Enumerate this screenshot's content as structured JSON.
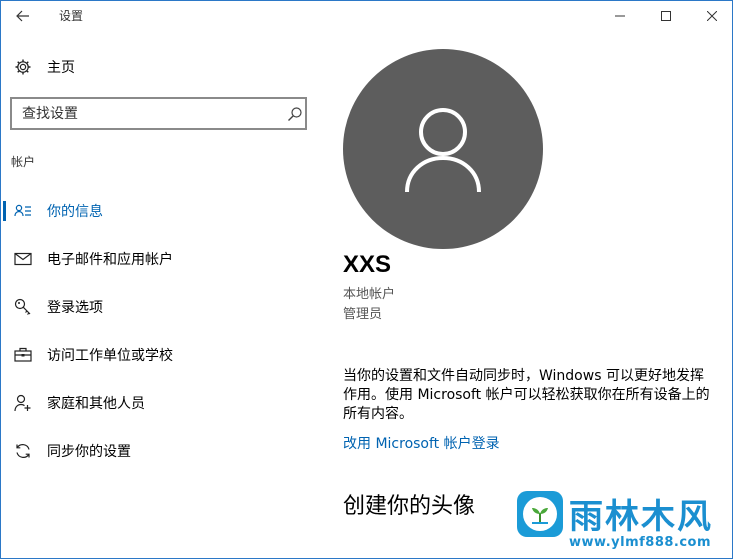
{
  "window": {
    "title": "设置"
  },
  "titlebar_icons": {
    "back": "back-arrow-icon",
    "minimize": "minimize-icon",
    "maximize": "maximize-icon",
    "close": "close-icon"
  },
  "nav": {
    "home_label": "主页",
    "search_placeholder": "查找设置",
    "section_header": "帐户",
    "items": [
      {
        "label": "你的信息",
        "icon": "user-info-icon",
        "active": true
      },
      {
        "label": "电子邮件和应用帐户",
        "icon": "mail-icon",
        "active": false
      },
      {
        "label": "登录选项",
        "icon": "key-icon",
        "active": false
      },
      {
        "label": "访问工作单位或学校",
        "icon": "briefcase-icon",
        "active": false
      },
      {
        "label": "家庭和其他人员",
        "icon": "add-person-icon",
        "active": false
      },
      {
        "label": "同步你的设置",
        "icon": "sync-icon",
        "active": false
      }
    ]
  },
  "profile": {
    "name": "XXS",
    "account_type": "本地帐户",
    "role": "管理员",
    "sync_note": "当你的设置和文件自动同步时，Windows 可以更好地发挥作用。使用 Microsoft 帐户可以轻松获取你在所有设备上的所有内容。",
    "ms_link": "改用 Microsoft 帐户登录",
    "avatar_heading": "创建你的头像"
  },
  "watermark": {
    "text": "雨林木风",
    "url": "www.ylmf888.com"
  },
  "colors": {
    "accent": "#0063b1",
    "avatar_bg": "#5d5d5d",
    "watermark": "#1b8fd0"
  }
}
